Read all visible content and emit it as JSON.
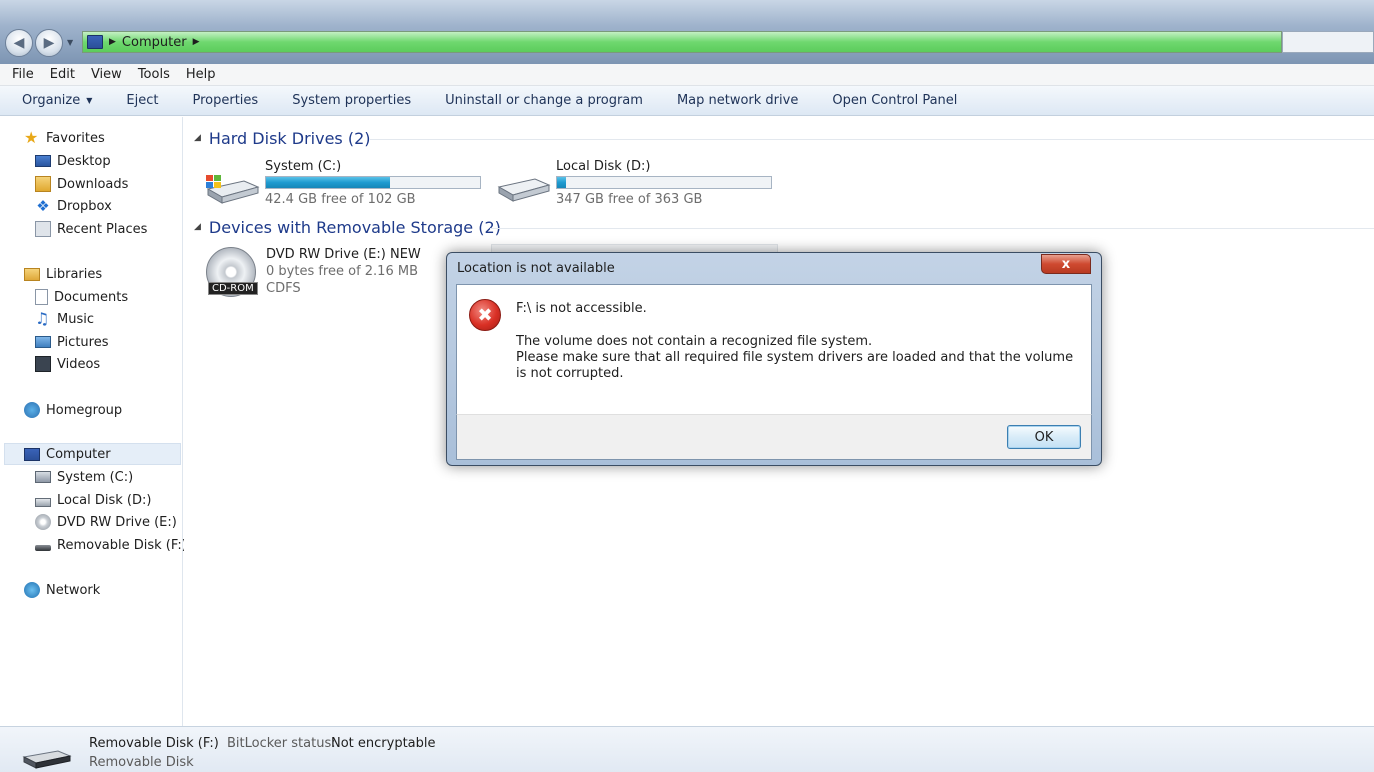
{
  "window": {
    "address_path": "Computer",
    "accent_color": "#4cc84c"
  },
  "menu": [
    "File",
    "Edit",
    "View",
    "Tools",
    "Help"
  ],
  "toolbar": {
    "organize": "Organize",
    "eject": "Eject",
    "properties": "Properties",
    "system_properties": "System properties",
    "uninstall": "Uninstall or change a program",
    "map_drive": "Map network drive",
    "control_panel": "Open Control Panel"
  },
  "sidebar": {
    "favorites": "Favorites",
    "desktop": "Desktop",
    "downloads": "Downloads",
    "dropbox": "Dropbox",
    "recent": "Recent Places",
    "libraries": "Libraries",
    "documents": "Documents",
    "music": "Music",
    "pictures": "Pictures",
    "videos": "Videos",
    "homegroup": "Homegroup",
    "computer": "Computer",
    "drive_c": "System  (C:)",
    "drive_d": "Local Disk (D:)",
    "drive_e": "DVD RW Drive (E:) N",
    "drive_f": "Removable Disk (F:)",
    "network": "Network"
  },
  "content": {
    "hdd_header": "Hard Disk Drives (2)",
    "removable_header": "Devices with Removable Storage (2)",
    "drives": [
      {
        "name": "System  (C:)",
        "free": "42.4 GB free of 102 GB",
        "used_fraction": 0.58
      },
      {
        "name": "Local Disk (D:)",
        "free": "347 GB free of 363 GB",
        "used_fraction": 0.04
      }
    ],
    "dvd": {
      "name": "DVD RW Drive (E:) NEW",
      "free": "0 bytes free of 2.16 MB",
      "fs": "CDFS",
      "badge": "CD-ROM"
    }
  },
  "dialog": {
    "title": "Location is not available",
    "close": "x",
    "main": "F:\\ is not accessible.",
    "detail_1": "The volume does not contain a recognized file system.",
    "detail_2": "Please make sure that all required file system drivers are loaded and that the volume is not corrupted.",
    "ok": "OK"
  },
  "details": {
    "name": "Removable Disk (F:)",
    "bitlocker_label": "BitLocker status:",
    "bitlocker_value": "Not encryptable",
    "type": "Removable Disk"
  }
}
